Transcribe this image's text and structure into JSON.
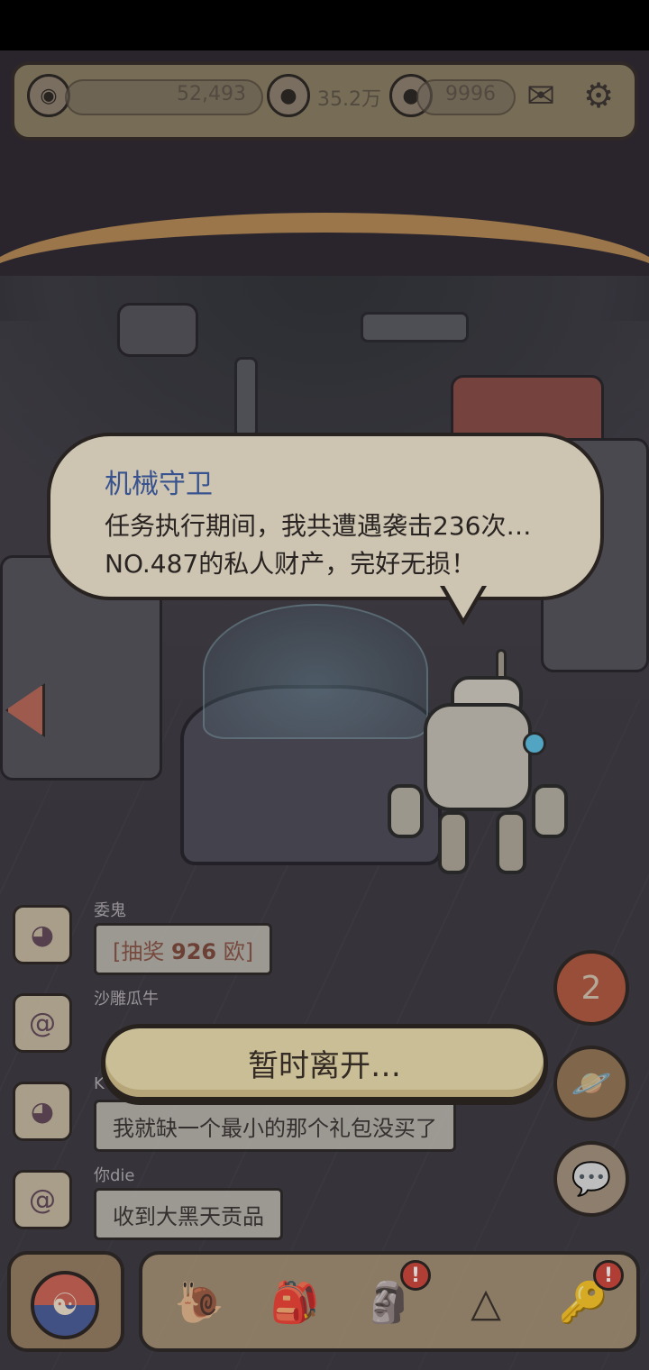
{
  "currency": {
    "eye_value": "52,493",
    "gem_value": "35.2万",
    "chat_value": "9996"
  },
  "icons": {
    "eye": "eye-icon",
    "bubble": "speech-bubble-icon",
    "mail": "mail-icon",
    "settings": "gear-icon",
    "back": "left-arrow-icon",
    "planet": "planet-icon",
    "chat": "chat-icon",
    "yinyang": "yinyang-icon",
    "snail": "snail-icon",
    "backpack": "backpack-icon",
    "statue": "statue-icon",
    "pyramid": "pyramid-icon",
    "key": "key-icon"
  },
  "dialog": {
    "speaker": "机械守卫",
    "line1": "任务执行期间，我共遭遇袭击236次…",
    "line2": "NO.487的私人财产，完好无损！"
  },
  "chat": [
    {
      "name": "委鬼",
      "prefix": "[抽奖 ",
      "highlight": "926",
      "suffix": " 欧]"
    },
    {
      "name": "沙雕瓜牛",
      "message": ""
    },
    {
      "name": "K",
      "message": "我就缺一个最小的那个礼包没买了"
    },
    {
      "name": "你die",
      "message": "收到大黑天贡品"
    }
  ],
  "badges": {
    "round_count": "2",
    "alert_mark": "!"
  },
  "leave_button": "暂时离开…",
  "colors": {
    "bubble_bg": "#f4ebd3",
    "speaker_text": "#3e5fa8",
    "button_bg": "#f0e2b1",
    "alert_red": "#d2463b"
  }
}
